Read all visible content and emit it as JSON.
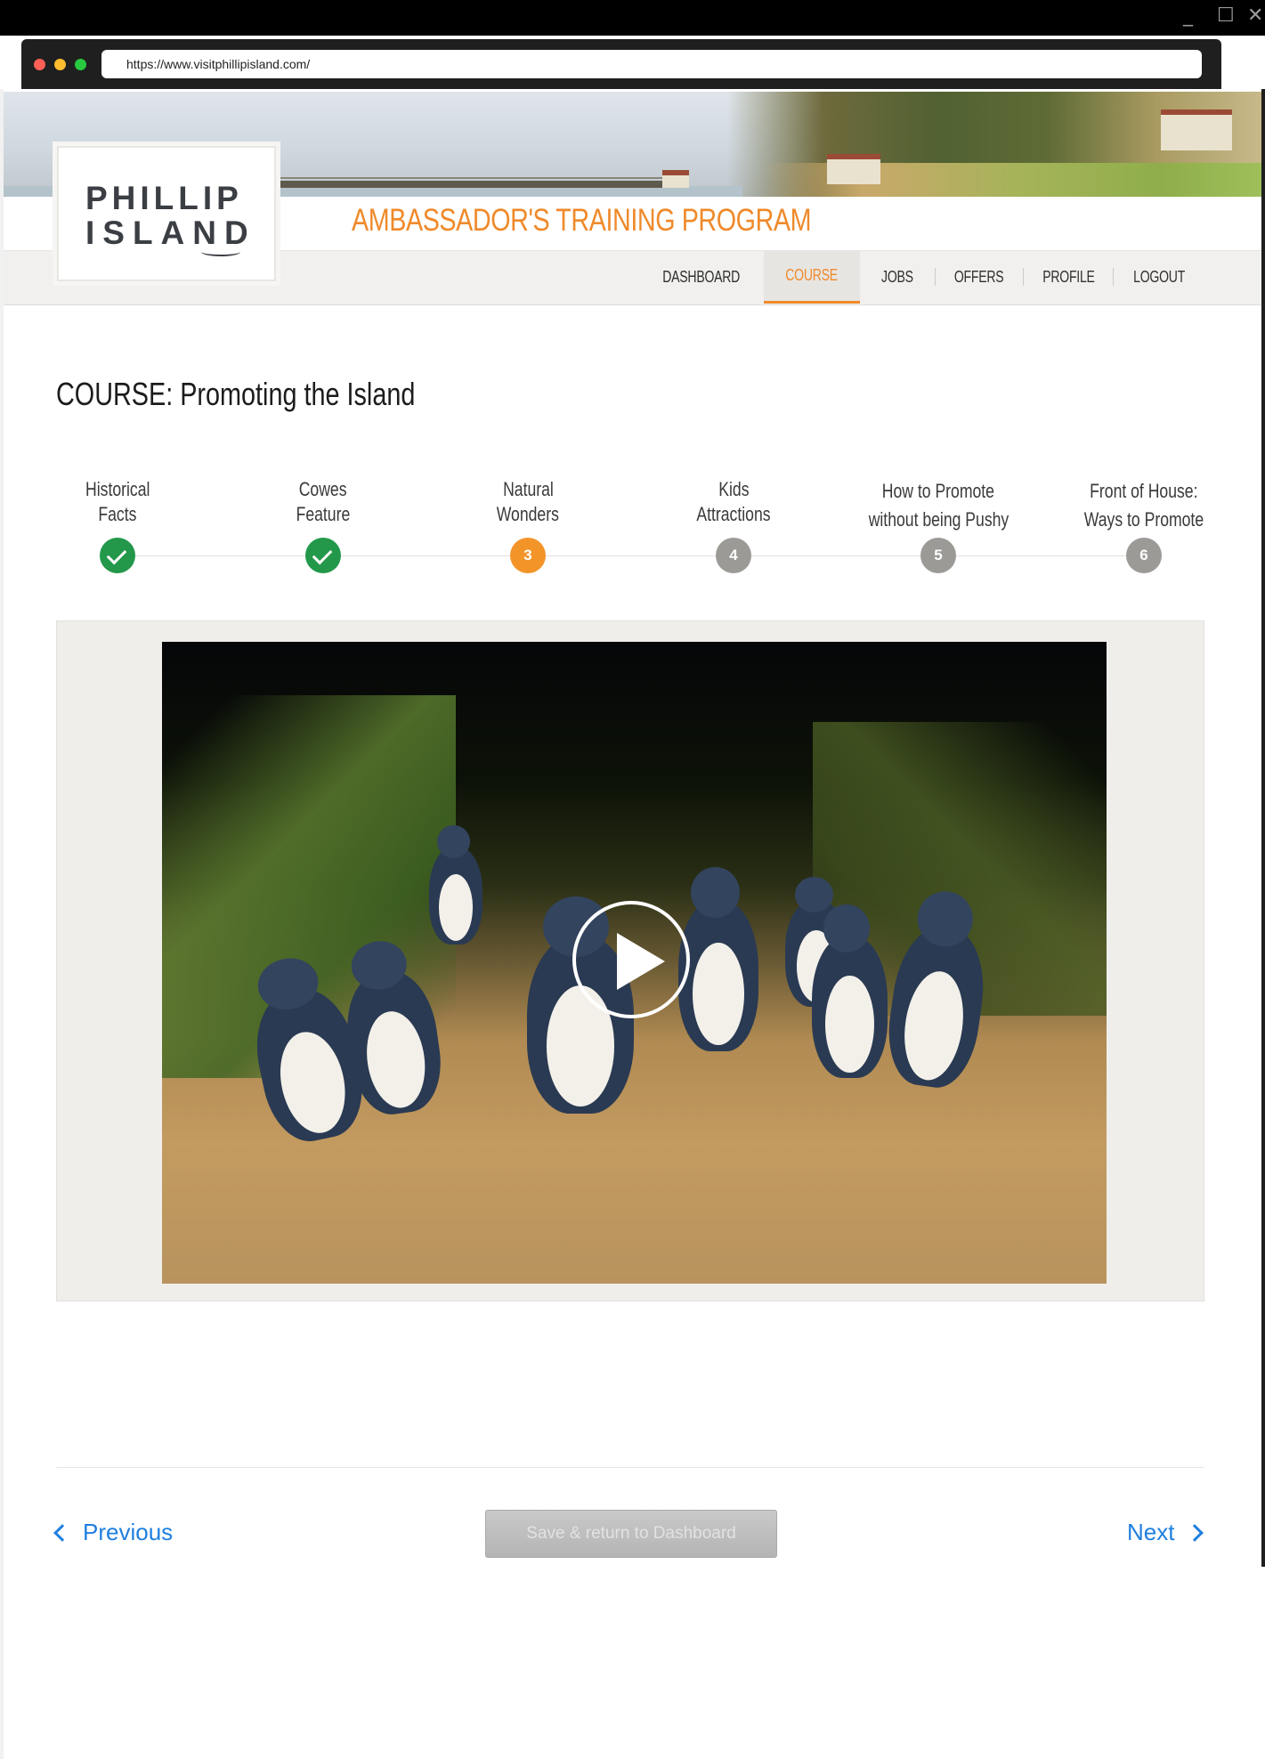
{
  "browser": {
    "url": "https://www.visitphillipisland.com/",
    "window_controls": {
      "minimize": "_",
      "maximize": "☐",
      "close": "✕"
    },
    "traffic_light_colors": [
      "#ff5f57",
      "#febc2e",
      "#28c840"
    ]
  },
  "header": {
    "logo_line1": "PHILLIP",
    "logo_line2": "ISLAND",
    "program_title": "AMBASSADOR'S TRAINING PROGRAM",
    "accent_color": "#ef8a2b"
  },
  "nav": {
    "items": [
      {
        "label": "DASHBOARD",
        "active": false
      },
      {
        "label": "COURSE",
        "active": true
      },
      {
        "label": "JOBS",
        "active": false
      },
      {
        "label": "OFFERS",
        "active": false
      },
      {
        "label": "PROFILE",
        "active": false
      },
      {
        "label": "LOGOUT",
        "active": false
      }
    ]
  },
  "course": {
    "title": "COURSE: Promoting the Island"
  },
  "steps": [
    {
      "line1": "Historical",
      "line2": "Facts",
      "status": "done",
      "number": "1"
    },
    {
      "line1": "Cowes",
      "line2": "Feature",
      "status": "done",
      "number": "2"
    },
    {
      "line1": "Natural",
      "line2": "Wonders",
      "status": "current",
      "number": "3"
    },
    {
      "line1": "Kids",
      "line2": "Attractions",
      "status": "todo",
      "number": "4"
    },
    {
      "line1": "How to Promote",
      "line2": "without being Pushy",
      "status": "todo",
      "number": "5"
    },
    {
      "line1": "Front of House:",
      "line2": "Ways to Promote",
      "status": "todo",
      "number": "6"
    }
  ],
  "video": {
    "icon": "play-icon"
  },
  "footer": {
    "previous_label": "Previous",
    "save_label": "Save & return to Dashboard",
    "next_label": "Next"
  }
}
